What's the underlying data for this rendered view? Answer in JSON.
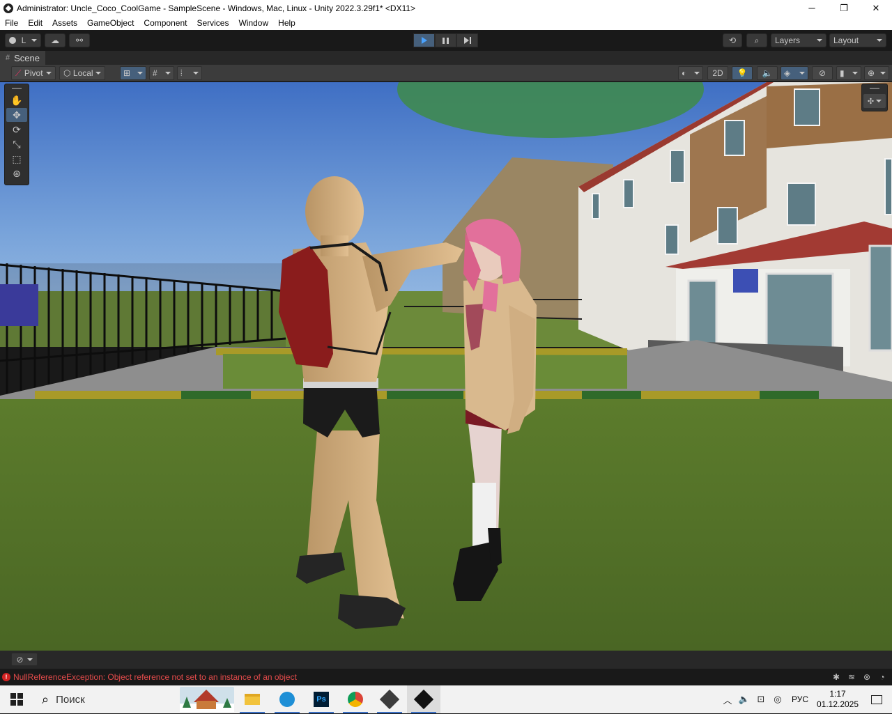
{
  "window": {
    "title": "Administrator: Uncle_Coco_CoolGame - SampleScene - Windows, Mac, Linux - Unity 2022.3.29f1* <DX11>",
    "minimize": "─",
    "maximize": "❐",
    "close": "✕"
  },
  "menu": {
    "items": [
      "File",
      "Edit",
      "Assets",
      "GameObject",
      "Component",
      "Services",
      "Window",
      "Help"
    ]
  },
  "toolbar": {
    "account_label": "L",
    "layers_label": "Layers",
    "layout_label": "Layout"
  },
  "scene": {
    "tab_label": "Scene",
    "pivot_label": "Pivot",
    "local_label": "Local",
    "mode_2d_label": "2D"
  },
  "status": {
    "error_message": "NullReferenceException: Object reference not set to an instance of an object"
  },
  "taskbar": {
    "search_placeholder": "Поиск",
    "language": "РУС",
    "time": "1:17",
    "date": "01.12.2025"
  },
  "colors": {
    "accent_blue": "#46607c",
    "error_red": "#e34b4b",
    "play_blue": "#4aa3ff"
  }
}
